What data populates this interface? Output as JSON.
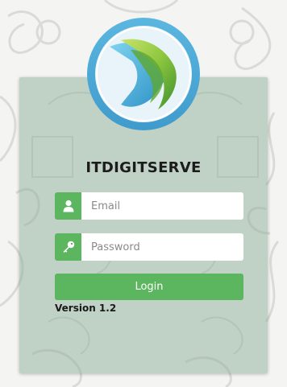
{
  "app": {
    "brand_name": "ITDIGITSERVE",
    "version_text": "Version 1.2"
  },
  "form": {
    "email": {
      "placeholder": "Email",
      "value": "",
      "icon": "user-icon"
    },
    "password": {
      "placeholder": "Password",
      "value": "",
      "icon": "key-icon"
    },
    "login_label": "Login"
  },
  "colors": {
    "accent_green": "#5cb65f",
    "card_tint": "#96b4a0",
    "logo_ring": "#4aa8d8",
    "logo_green": "#8cc63f",
    "text_dark": "#1c1c1c"
  }
}
